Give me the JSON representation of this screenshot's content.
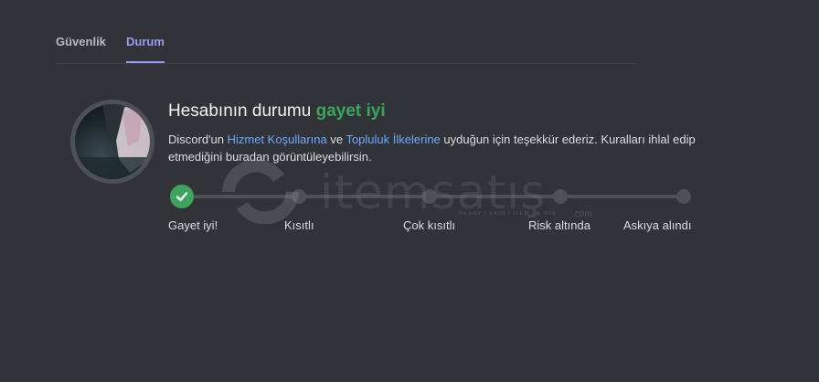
{
  "tabs": {
    "security": "Güvenlik",
    "status": "Durum"
  },
  "status": {
    "headline_prefix": "Hesabının durumu",
    "headline_value": "gayet iyi",
    "desc_1": "Discord'un ",
    "link_tos": "Hizmet Koşullarına",
    "desc_2": " ve ",
    "link_guidelines": "Topluluk İlkelerine",
    "desc_3": " uyduğun için teşekkür ederiz. Kuralları ihlal edip etmediğini buradan görüntüleyebilirsin."
  },
  "steps": {
    "s1": "Gayet iyi!",
    "s2": "Kısıtlı",
    "s3": "Çok kısıtlı",
    "s4": "Risk altında",
    "s5": "Askıya alındı"
  },
  "watermark": {
    "brand": "itemsatış",
    "tagline": "HESAP / SKIN / ITEM / E-PIN",
    "domain": ".com"
  },
  "colors": {
    "background": "#313338",
    "accent": "#949cf7",
    "success": "#3ba55d",
    "link": "#6fa8ff"
  }
}
